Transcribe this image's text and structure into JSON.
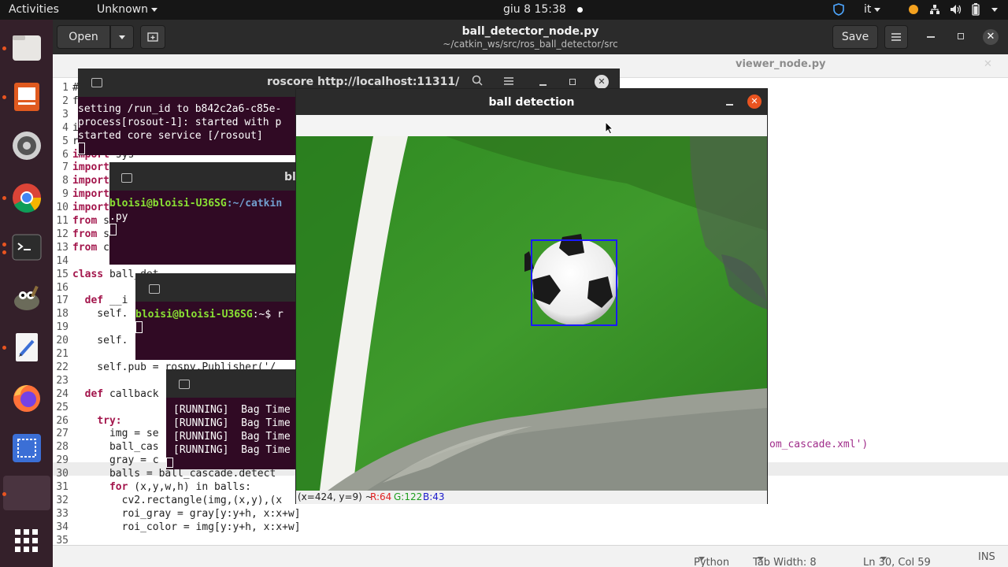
{
  "topbar": {
    "activities": "Activities",
    "app_menu": "Unknown",
    "clock": "giu 8  15:38",
    "lang": "it"
  },
  "gedit": {
    "open_label": "Open",
    "title": "ball_detector_node.py",
    "subtitle": "~/catkin_ws/src/ros_ball_detector/src",
    "save_label": "Save",
    "tab_viewer": "viewer_node.py",
    "code": [
      {
        "n": "1",
        "t": "#"
      },
      {
        "n": "2",
        "t": "f"
      },
      {
        "n": "3",
        "t": ""
      },
      {
        "n": "4",
        "t": "i"
      },
      {
        "n": "5",
        "t": "r"
      },
      {
        "n": "6",
        "t": "import sys"
      },
      {
        "n": "7",
        "t": "import"
      },
      {
        "n": "8",
        "t": "import"
      },
      {
        "n": "9",
        "t": "import"
      },
      {
        "n": "10",
        "t": "import"
      },
      {
        "n": "11",
        "t": "from s"
      },
      {
        "n": "12",
        "t": "from s"
      },
      {
        "n": "13",
        "t": "from c"
      },
      {
        "n": "14",
        "t": ""
      },
      {
        "n": "15",
        "t": "class ball_det"
      },
      {
        "n": "16",
        "t": ""
      },
      {
        "n": "17",
        "t": "  def __i"
      },
      {
        "n": "18",
        "t": "    self."
      },
      {
        "n": "19",
        "t": ""
      },
      {
        "n": "20",
        "t": "    self."
      },
      {
        "n": "21",
        "t": ""
      },
      {
        "n": "22",
        "t": "    self.pub = rospy.Publisher('/"
      },
      {
        "n": "23",
        "t": ""
      },
      {
        "n": "24",
        "t": "  def callback"
      },
      {
        "n": "25",
        "t": ""
      },
      {
        "n": "26",
        "t": "    try:"
      },
      {
        "n": "27",
        "t": "      img = se"
      },
      {
        "n": "28",
        "t": "      ball_cas"
      },
      {
        "n": "29",
        "t": "      gray = c"
      },
      {
        "n": "30",
        "t": "      balls = ball_cascade.detect"
      },
      {
        "n": "31",
        "t": "      for (x,y,w,h) in balls:"
      },
      {
        "n": "32",
        "t": "        cv2.rectangle(img,(x,y),(x"
      },
      {
        "n": "33",
        "t": "        roi_gray = gray[y:y+h, x:x+w]"
      },
      {
        "n": "34",
        "t": "        roi_color = img[y:y+h, x:x+w]"
      },
      {
        "n": "35",
        "t": ""
      }
    ],
    "code_tail_28": "om_cascade.xml')",
    "status": {
      "lang": "Python",
      "tab_width": "Tab Width: 8",
      "position": "Ln 30, Col 59",
      "mode": "INS"
    }
  },
  "roscore": {
    "title": "roscore http://localhost:11311/",
    "lines": [
      "setting /run_id to b842c2a6-c85e-",
      "process[rosout-1]: started with p",
      "started core service [/rosout]"
    ]
  },
  "term2": {
    "title_frag": "bl",
    "prompt_user": "bloisi@bloisi-U36SG",
    "prompt_path": ":~/catkin",
    "line2": ".py"
  },
  "term3": {
    "prompt_user": "bloisi@bloisi-U36SG",
    "prompt_rest": ":~$ r"
  },
  "term4": {
    "lines": [
      "[RUNNING]  Bag Time",
      "[RUNNING]  Bag Time",
      "[RUNNING]  Bag Time",
      "[RUNNING]  Bag Time"
    ]
  },
  "ball_window": {
    "title": "ball detection",
    "status_coords": "(x=424, y=9) ~",
    "r_label": "R:64",
    "g_label": "G:122",
    "b_label": "B:43"
  },
  "colors": {
    "accent": "#e95420",
    "terminal_bg": "#300a24",
    "detect_box": "#1a1aff"
  }
}
